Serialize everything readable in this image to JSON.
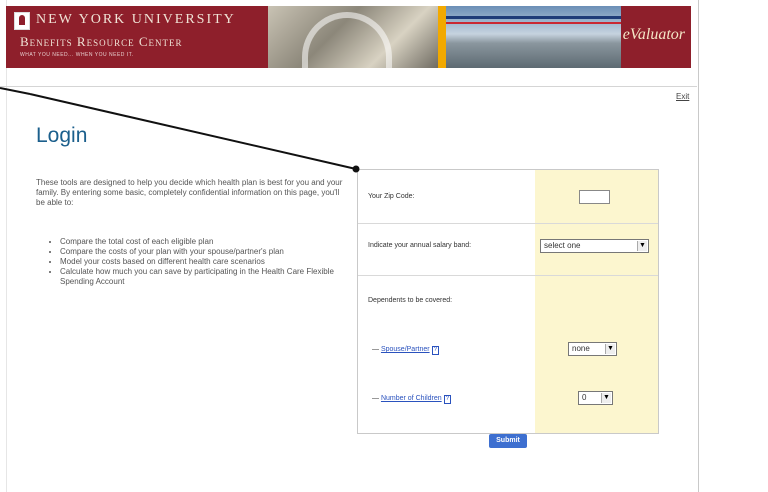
{
  "banner": {
    "university": "NEW YORK UNIVERSITY",
    "center": "Benefits Resource Center",
    "tagline": "WHAT YOU NEED... WHEN YOU NEED IT.",
    "product": "eValuator"
  },
  "header": {
    "exit_label": "Exit"
  },
  "main": {
    "title": "Login",
    "intro": "These tools are designed to help you decide which health plan is best for you and your family. By entering some basic, completely confidential information on this page, you'll be able to:",
    "bullets": [
      "Compare the total cost of each eligible plan",
      "Compare the costs of your plan with your spouse/partner's plan",
      "Model your costs based on different health care scenarios",
      "Calculate how much you can save by participating in the Health Care Flexible Spending Account"
    ]
  },
  "form": {
    "zip_label": "Your Zip Code:",
    "zip_value": "",
    "salary_label": "Indicate your annual salary band:",
    "salary_selected": "select one",
    "dependents_label": "Dependents to be covered:",
    "spouse_label": "Spouse/Partner",
    "spouse_selected": "none",
    "children_label": "Number of Children",
    "children_selected": "0",
    "help_glyph": "?",
    "submit_label": "Submit"
  },
  "colors": {
    "brand_red": "#8e1f2b",
    "title_blue": "#1b5f8c",
    "highlight": "#fcf6cf",
    "button": "#3d6fd0"
  }
}
